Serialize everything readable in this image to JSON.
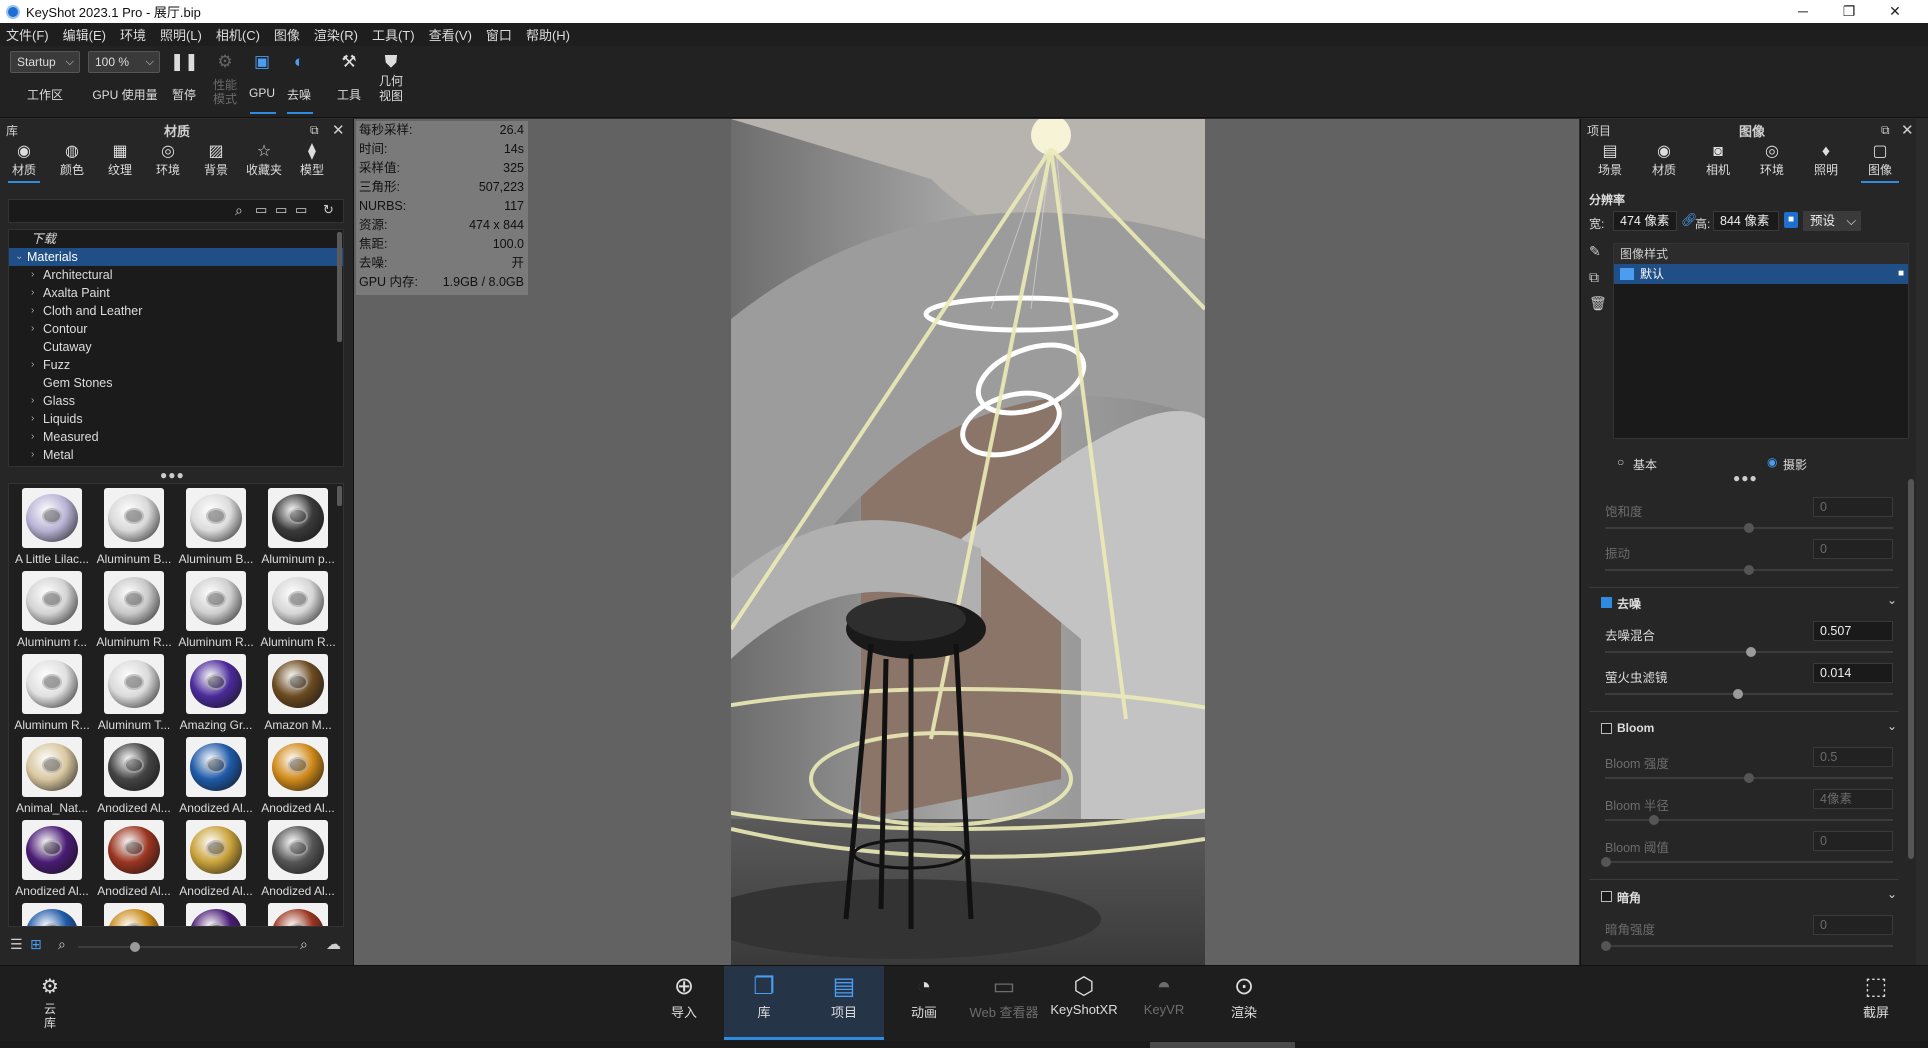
{
  "window": {
    "title": "KeyShot 2023.1 Pro  - 展厅.bip",
    "minimize": "─",
    "maximize": "❐",
    "close": "✕"
  },
  "menu": [
    "文件(F)",
    "编辑(E)",
    "环境",
    "照明(L)",
    "相机(C)",
    "图像",
    "渲染(R)",
    "工具(T)",
    "查看(V)",
    "窗口",
    "帮助(H)"
  ],
  "toolbar": {
    "workspace_value": "Startup",
    "workspace_label": "工作区",
    "gpu_usage_value": "100 %",
    "gpu_usage_label": "GPU 使用量",
    "pause_label": "暂停",
    "perf_label_1": "性能",
    "perf_label_2": "模式",
    "gpu_label": "GPU",
    "denoise_label": "去噪",
    "tools_label": "工具",
    "geo_label_1": "几何",
    "geo_label_2": "视图"
  },
  "library": {
    "panel_label": "库",
    "panel_title": "材质",
    "tabs": [
      "材质",
      "颜色",
      "纹理",
      "环境",
      "背景",
      "收藏夹",
      "模型"
    ],
    "tree": {
      "top": "下载",
      "selected": "Materials",
      "items": [
        "Architectural",
        "Axalta Paint",
        "Cloth and Leather",
        "Contour",
        "Cutaway",
        "Fuzz",
        "Gem Stones",
        "Glass",
        "Liquids",
        "Measured",
        "Metal"
      ],
      "expandable": [
        true,
        true,
        true,
        true,
        false,
        true,
        false,
        true,
        true,
        true,
        true
      ]
    },
    "thumbs": [
      {
        "label": "A Little Lilac...",
        "color": "#b9b4d6"
      },
      {
        "label": "Aluminum B...",
        "color": "#d9d9d9"
      },
      {
        "label": "Aluminum B...",
        "color": "#dcdcdc"
      },
      {
        "label": "Aluminum p...",
        "color": "#3a3a3a"
      },
      {
        "label": "Aluminum r...",
        "color": "#d4d4d4"
      },
      {
        "label": "Aluminum R...",
        "color": "#c8c8c8"
      },
      {
        "label": "Aluminum R...",
        "color": "#cfcfcf"
      },
      {
        "label": "Aluminum R...",
        "color": "#d6d6d6"
      },
      {
        "label": "Aluminum R...",
        "color": "#e0e0e0"
      },
      {
        "label": "Aluminum T...",
        "color": "#dadada"
      },
      {
        "label": "Amazing Gr...",
        "color": "#4b2a9a"
      },
      {
        "label": "Amazon M...",
        "color": "#6b4a20"
      },
      {
        "label": "Animal_Nat...",
        "color": "#d8c7a0"
      },
      {
        "label": "Anodized Al...",
        "color": "#444444"
      },
      {
        "label": "Anodized Al...",
        "color": "#1f5aa8"
      },
      {
        "label": "Anodized Al...",
        "color": "#d08a1a"
      },
      {
        "label": "Anodized Al...",
        "color": "#4a1c74"
      },
      {
        "label": "Anodized Al...",
        "color": "#9a3520"
      },
      {
        "label": "Anodized Al...",
        "color": "#c9a23a"
      },
      {
        "label": "Anodized Al...",
        "color": "#555555"
      },
      {
        "label": "",
        "color": "#1f5aa8"
      },
      {
        "label": "",
        "color": "#c98a1a"
      },
      {
        "label": "",
        "color": "#4a1c74"
      },
      {
        "label": "",
        "color": "#9a3520"
      }
    ]
  },
  "hud": {
    "rows": [
      {
        "k": "每秒采样:",
        "v": "26.4"
      },
      {
        "k": "时间:",
        "v": "14s"
      },
      {
        "k": "采样值:",
        "v": "325"
      },
      {
        "k": "三角形:",
        "v": "507,223"
      },
      {
        "k": "NURBS:",
        "v": "117"
      },
      {
        "k": "资源:",
        "v": "474 x 844"
      },
      {
        "k": "焦距:",
        "v": "100.0"
      },
      {
        "k": "去噪:",
        "v": "开"
      },
      {
        "k": "GPU 内存:",
        "v": "1.9GB / 8.0GB"
      }
    ]
  },
  "project": {
    "panel_label": "项目",
    "panel_title": "图像",
    "tabs": [
      "场景",
      "材质",
      "相机",
      "环境",
      "照明",
      "图像"
    ],
    "resolution_label": "分辨率",
    "width_label": "宽:",
    "width_value": "474 像素",
    "height_label": "高:",
    "height_value": "844 像素",
    "preset_label": "预设",
    "image_style_label": "图像样式",
    "default_style": "默认",
    "mode_basic": "基本",
    "mode_photo": "摄影",
    "saturation_label": "饱和度",
    "saturation_value": "0",
    "vibration_label": "振动",
    "vibration_value": "0",
    "denoise_section": "去噪",
    "denoise_blend_label": "去噪混合",
    "denoise_blend_value": "0.507",
    "firefly_label": "萤火虫滤镜",
    "firefly_value": "0.014",
    "bloom_section": "Bloom",
    "bloom_strength_label": "Bloom 强度",
    "bloom_strength_value": "0.5",
    "bloom_radius_label": "Bloom 半径",
    "bloom_radius_value": "4像素",
    "bloom_threshold_label": "Bloom 阈值",
    "bloom_threshold_value": "0",
    "vignette_section": "暗角",
    "vignette_strength_label": "暗角强度",
    "vignette_strength_value": "0"
  },
  "bottom": {
    "cloud_label_1": "云",
    "cloud_label_2": "库",
    "buttons": [
      "导入",
      "库",
      "项目",
      "动画",
      "Web 查看器",
      "KeyShotXR",
      "KeyVR",
      "渲染"
    ],
    "screenshot_label": "截屏"
  },
  "colors": {
    "accent": "#2f8be0",
    "selection": "#1f4f86",
    "panel": "#262626",
    "viewport": "#626262"
  }
}
